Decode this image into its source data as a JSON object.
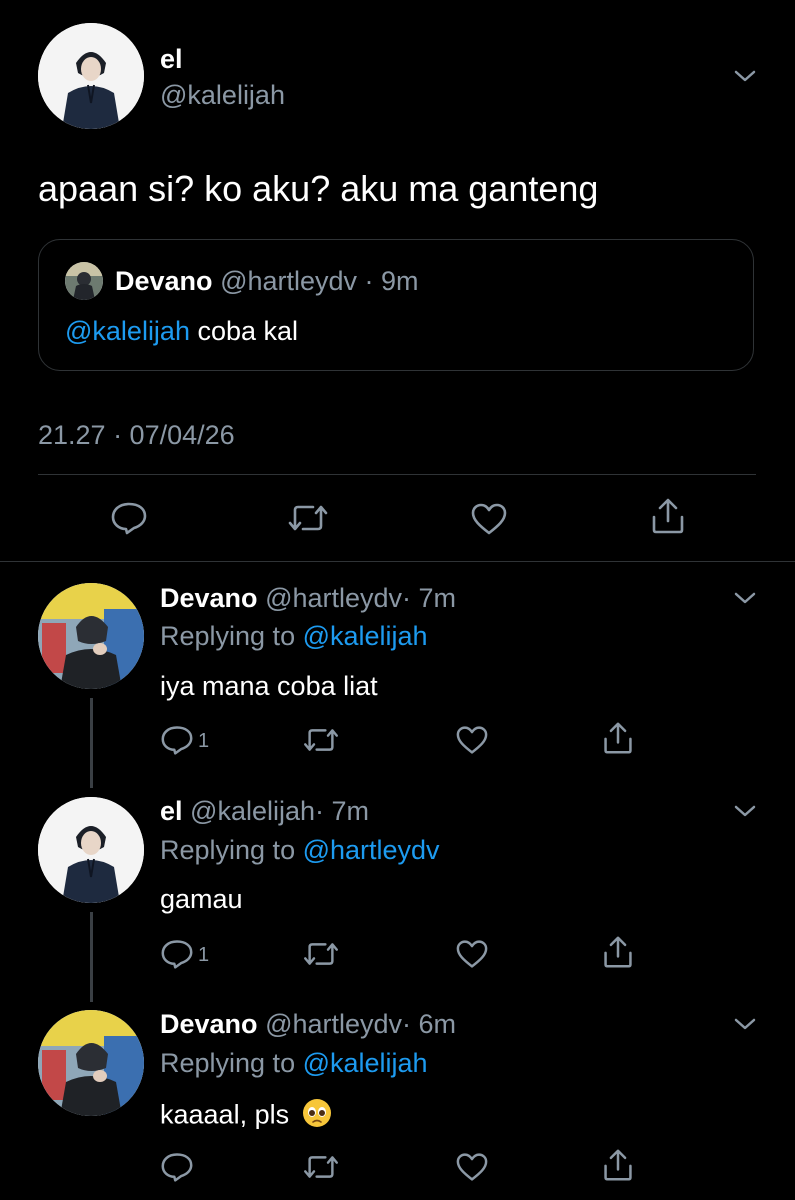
{
  "main_tweet": {
    "name": "el",
    "handle": "@kalelijah",
    "text": "apaan si? ko aku? aku ma ganteng",
    "timestamp": "21.27 · 07/04/26",
    "quote": {
      "name": "Devano",
      "handle": "@hartleydv",
      "time": "· 9m",
      "mention": "@kalelijah",
      "text": " coba kal"
    }
  },
  "replies": [
    {
      "name": "Devano",
      "handle": "@hartleydv",
      "time": "· 7m",
      "replying_label": "Replying to ",
      "replying_to": "@kalelijah",
      "text": "iya mana coba liat",
      "reply_count": "1"
    },
    {
      "name": "el",
      "handle": "@kalelijah",
      "time": "· 7m",
      "replying_label": "Replying to ",
      "replying_to": "@hartleydv",
      "text": "gamau",
      "reply_count": "1"
    },
    {
      "name": "Devano",
      "handle": "@hartleydv",
      "time": "· 6m",
      "replying_label": "Replying to ",
      "replying_to": "@kalelijah",
      "text": "kaaaal, pls",
      "emoji": "🥺",
      "reply_count": ""
    }
  ],
  "icons": [
    "reply-icon",
    "retweet-icon",
    "like-icon",
    "share-icon",
    "chevron-down-icon"
  ],
  "colors": {
    "background": "#000000",
    "text": "#ffffff",
    "muted": "#8b98a5",
    "link": "#1d9bf0",
    "divider": "#2f3336"
  }
}
